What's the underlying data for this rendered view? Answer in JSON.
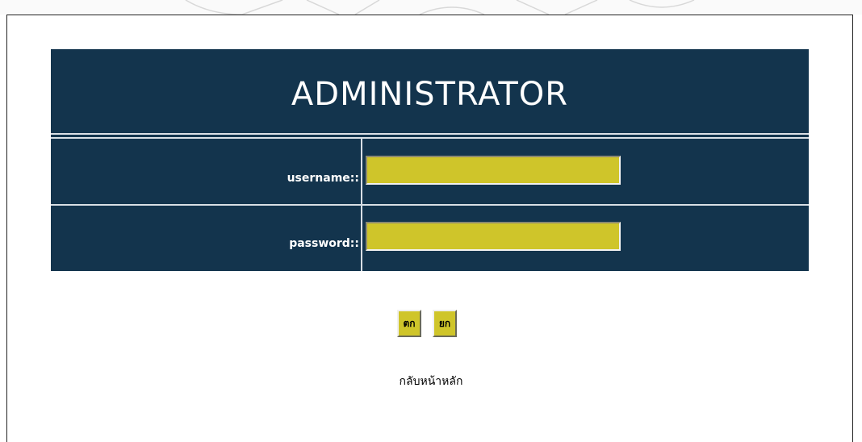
{
  "header": {
    "title": "ADMINISTRATOR"
  },
  "form": {
    "username_label": "username::",
    "username_value": "",
    "password_label": "password::",
    "password_value": ""
  },
  "buttons": {
    "submit_label": "ตก",
    "reset_label": "ยก"
  },
  "links": {
    "home_label": "กลับหน้าหลัก"
  },
  "colors": {
    "table_background": "#13344d",
    "input_background": "#cfc52a",
    "divider": "#d9dfe5",
    "page_background": "#ffffff"
  }
}
